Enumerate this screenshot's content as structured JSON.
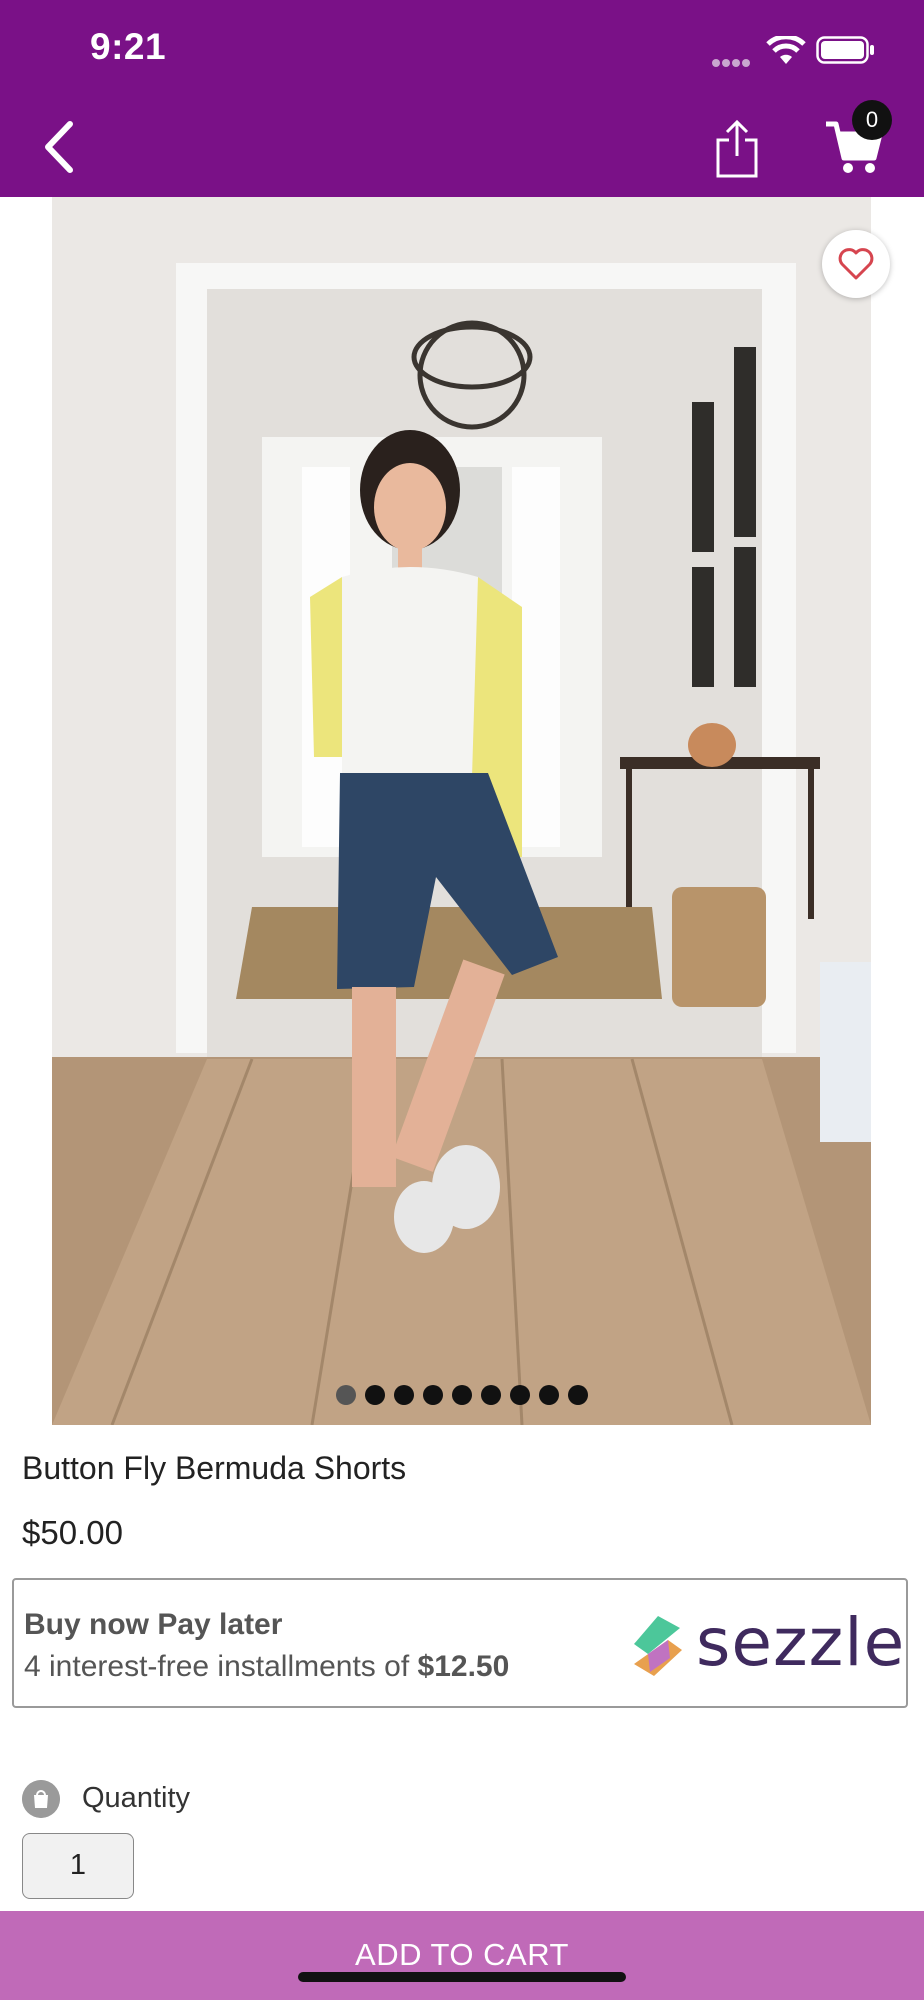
{
  "status_bar": {
    "time": "9:21"
  },
  "header": {
    "cart_count": "0"
  },
  "product": {
    "title": "Button Fly Bermuda Shorts",
    "price": "$50.00",
    "image_count": 9,
    "active_image_index": 0
  },
  "sezzle": {
    "heading": "Buy now Pay later",
    "installments_text": "4 interest-free installments of ",
    "installment_amount": "$12.50",
    "brand": "sezzle"
  },
  "quantity": {
    "label": "Quantity",
    "value": "1"
  },
  "cta": {
    "add_to_cart_label": "ADD TO CART"
  },
  "colors": {
    "brand_purple": "#7a1187",
    "cta_pink": "#c06ab8",
    "sezzle_purple": "#3f2a5e"
  }
}
